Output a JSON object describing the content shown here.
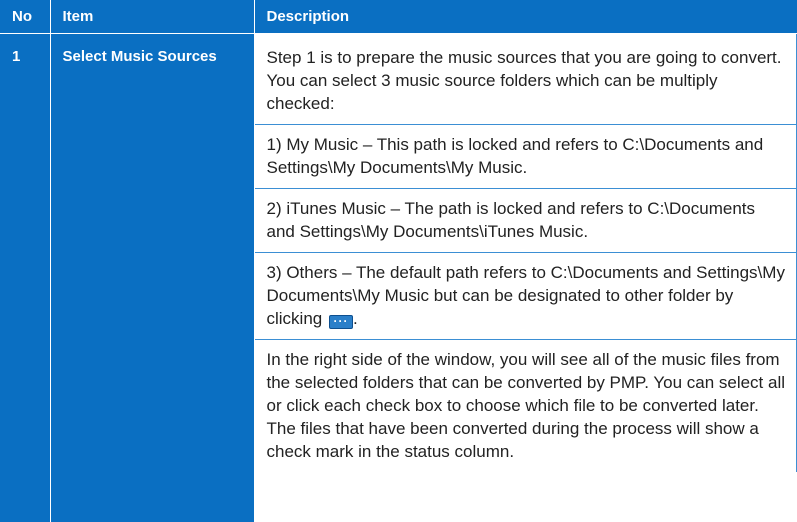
{
  "table": {
    "headers": {
      "no": "No",
      "item": "Item",
      "description": "Description"
    },
    "rows": [
      {
        "no": "1",
        "item": "Select Music Sources",
        "paragraphs": [
          "Step 1 is to prepare the music sources that you are going to convert. You can select 3 music source folders which can be multiply checked:",
          "1) My Music – This path is locked and refers to C:\\Documents and Settings\\My Documents\\My Music.",
          "2) iTunes Music – The path is locked and refers to C:\\Documents and Settings\\My Documents\\iTunes Music.",
          "3) Others – The default path refers to C:\\Documents and Settings\\My Documents\\My Music but can be designated to other folder by clicking",
          "In the right side of the window, you will see all of the music files from the selected folders that can be converted by PMP. You can select all or click each check box to choose which file to be converted later. The files that have been converted during the process will show a check mark in the status column."
        ],
        "paragraph_4_suffix": ".",
        "inline_icon": "browse-ellipsis-icon"
      }
    ]
  }
}
